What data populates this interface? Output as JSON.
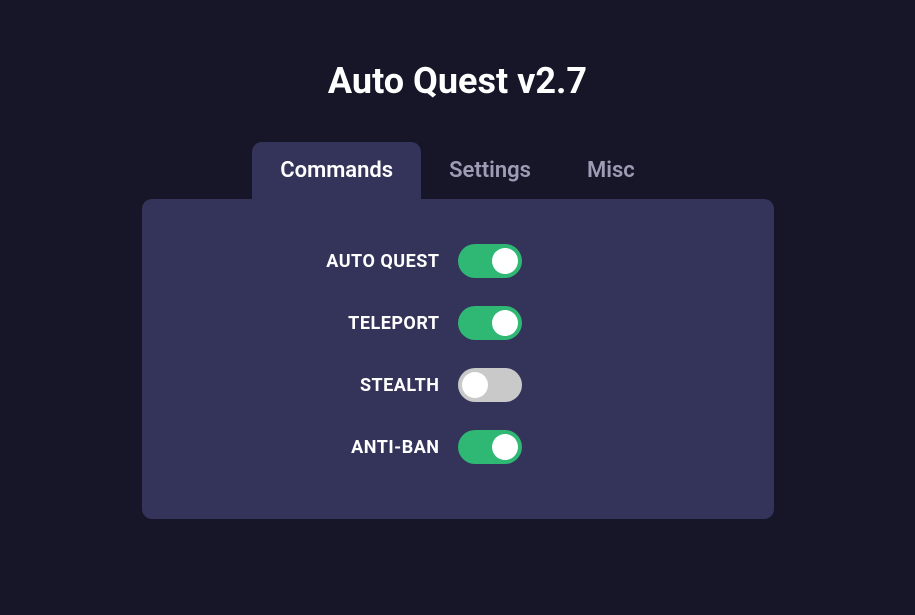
{
  "title": "Auto Quest v2.7",
  "tabs": [
    {
      "label": "Commands",
      "active": true
    },
    {
      "label": "Settings",
      "active": false
    },
    {
      "label": "Misc",
      "active": false
    }
  ],
  "commands": [
    {
      "label": "AUTO QUEST",
      "enabled": true
    },
    {
      "label": "TELEPORT",
      "enabled": true
    },
    {
      "label": "STEALTH",
      "enabled": false
    },
    {
      "label": "ANTI-BAN",
      "enabled": true
    }
  ]
}
